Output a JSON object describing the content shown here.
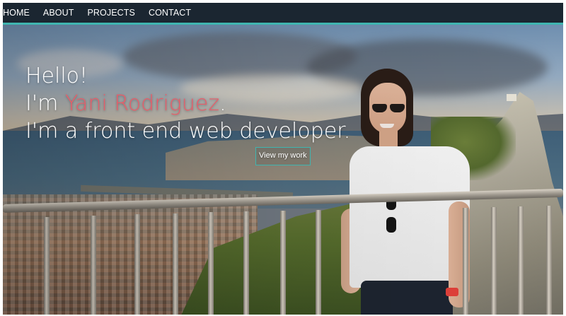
{
  "nav": {
    "items": [
      {
        "label": "HOME"
      },
      {
        "label": "ABOUT"
      },
      {
        "label": "PROJECTS"
      },
      {
        "label": "CONTACT"
      }
    ],
    "background": "#1b2631",
    "accent": "#3fb5b0"
  },
  "hero": {
    "greeting": "Hello!",
    "name_prefix": "I'm ",
    "name": "Yani Rodriguez",
    "name_suffix": ".",
    "tagline": "I'm a front end web developer.",
    "name_color": "#e85d6a",
    "cta_label": "View my work",
    "cta_border_color": "#3fb5b0",
    "photo_alt": "woman-on-overlook-photo"
  }
}
